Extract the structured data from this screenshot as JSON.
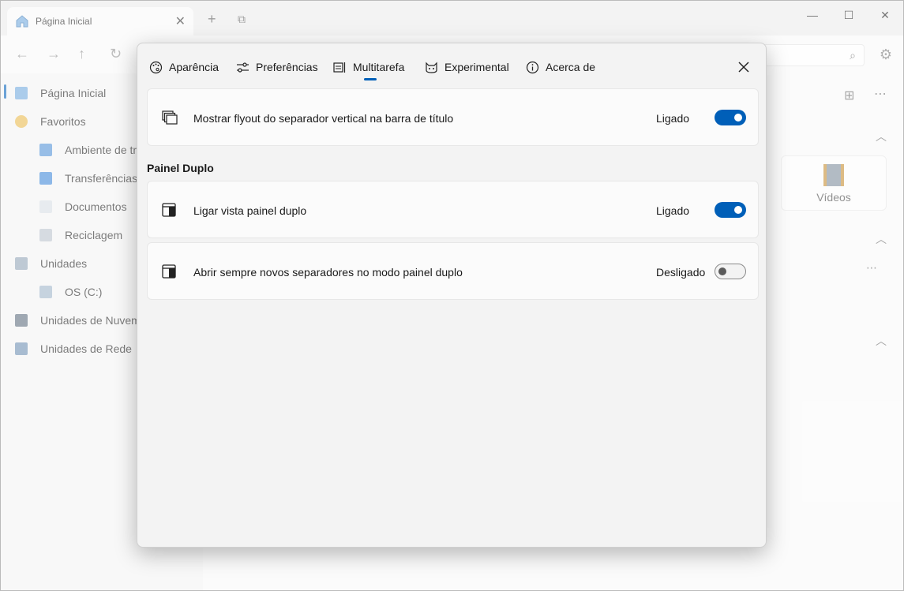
{
  "app": {
    "tab_title": "Página Inicial",
    "sidebar": [
      {
        "label": "Página Inicial",
        "icon": "home-icon"
      },
      {
        "label": "Favoritos",
        "icon": "star-icon"
      },
      {
        "label": "Ambiente de tr",
        "icon": "desktop-icon"
      },
      {
        "label": "Transferências",
        "icon": "download-icon"
      },
      {
        "label": "Documentos",
        "icon": "document-icon"
      },
      {
        "label": "Reciclagem",
        "icon": "recycle-bin-icon"
      },
      {
        "label": "Unidades",
        "icon": "drives-icon"
      },
      {
        "label": "OS (C:)",
        "icon": "disk-icon"
      },
      {
        "label": "Unidades de Nuvem",
        "icon": "cloud-icon"
      },
      {
        "label": "Unidades de Rede",
        "icon": "network-icon"
      }
    ],
    "videos_label": "Vídeos"
  },
  "dialog": {
    "tabs": [
      {
        "label": "Aparência",
        "icon": "palette-icon"
      },
      {
        "label": "Preferências",
        "icon": "sliders-icon"
      },
      {
        "label": "Multitarefa",
        "icon": "multitask-icon"
      },
      {
        "label": "Experimental",
        "icon": "cat-icon"
      },
      {
        "label": "Acerca de",
        "icon": "info-icon"
      }
    ],
    "active_tab": "Multitarefa",
    "settings": [
      {
        "label": "Mostrar flyout do separador vertical na barra de título",
        "state": "Ligado",
        "on": true
      },
      {
        "label": "Ligar vista painel duplo",
        "state": "Ligado",
        "on": true
      },
      {
        "label": "Abrir sempre novos separadores no modo painel duplo",
        "state": "Desligado",
        "on": false
      }
    ],
    "section_title": "Painel Duplo"
  },
  "colors": {
    "accent": "#005fb8"
  }
}
